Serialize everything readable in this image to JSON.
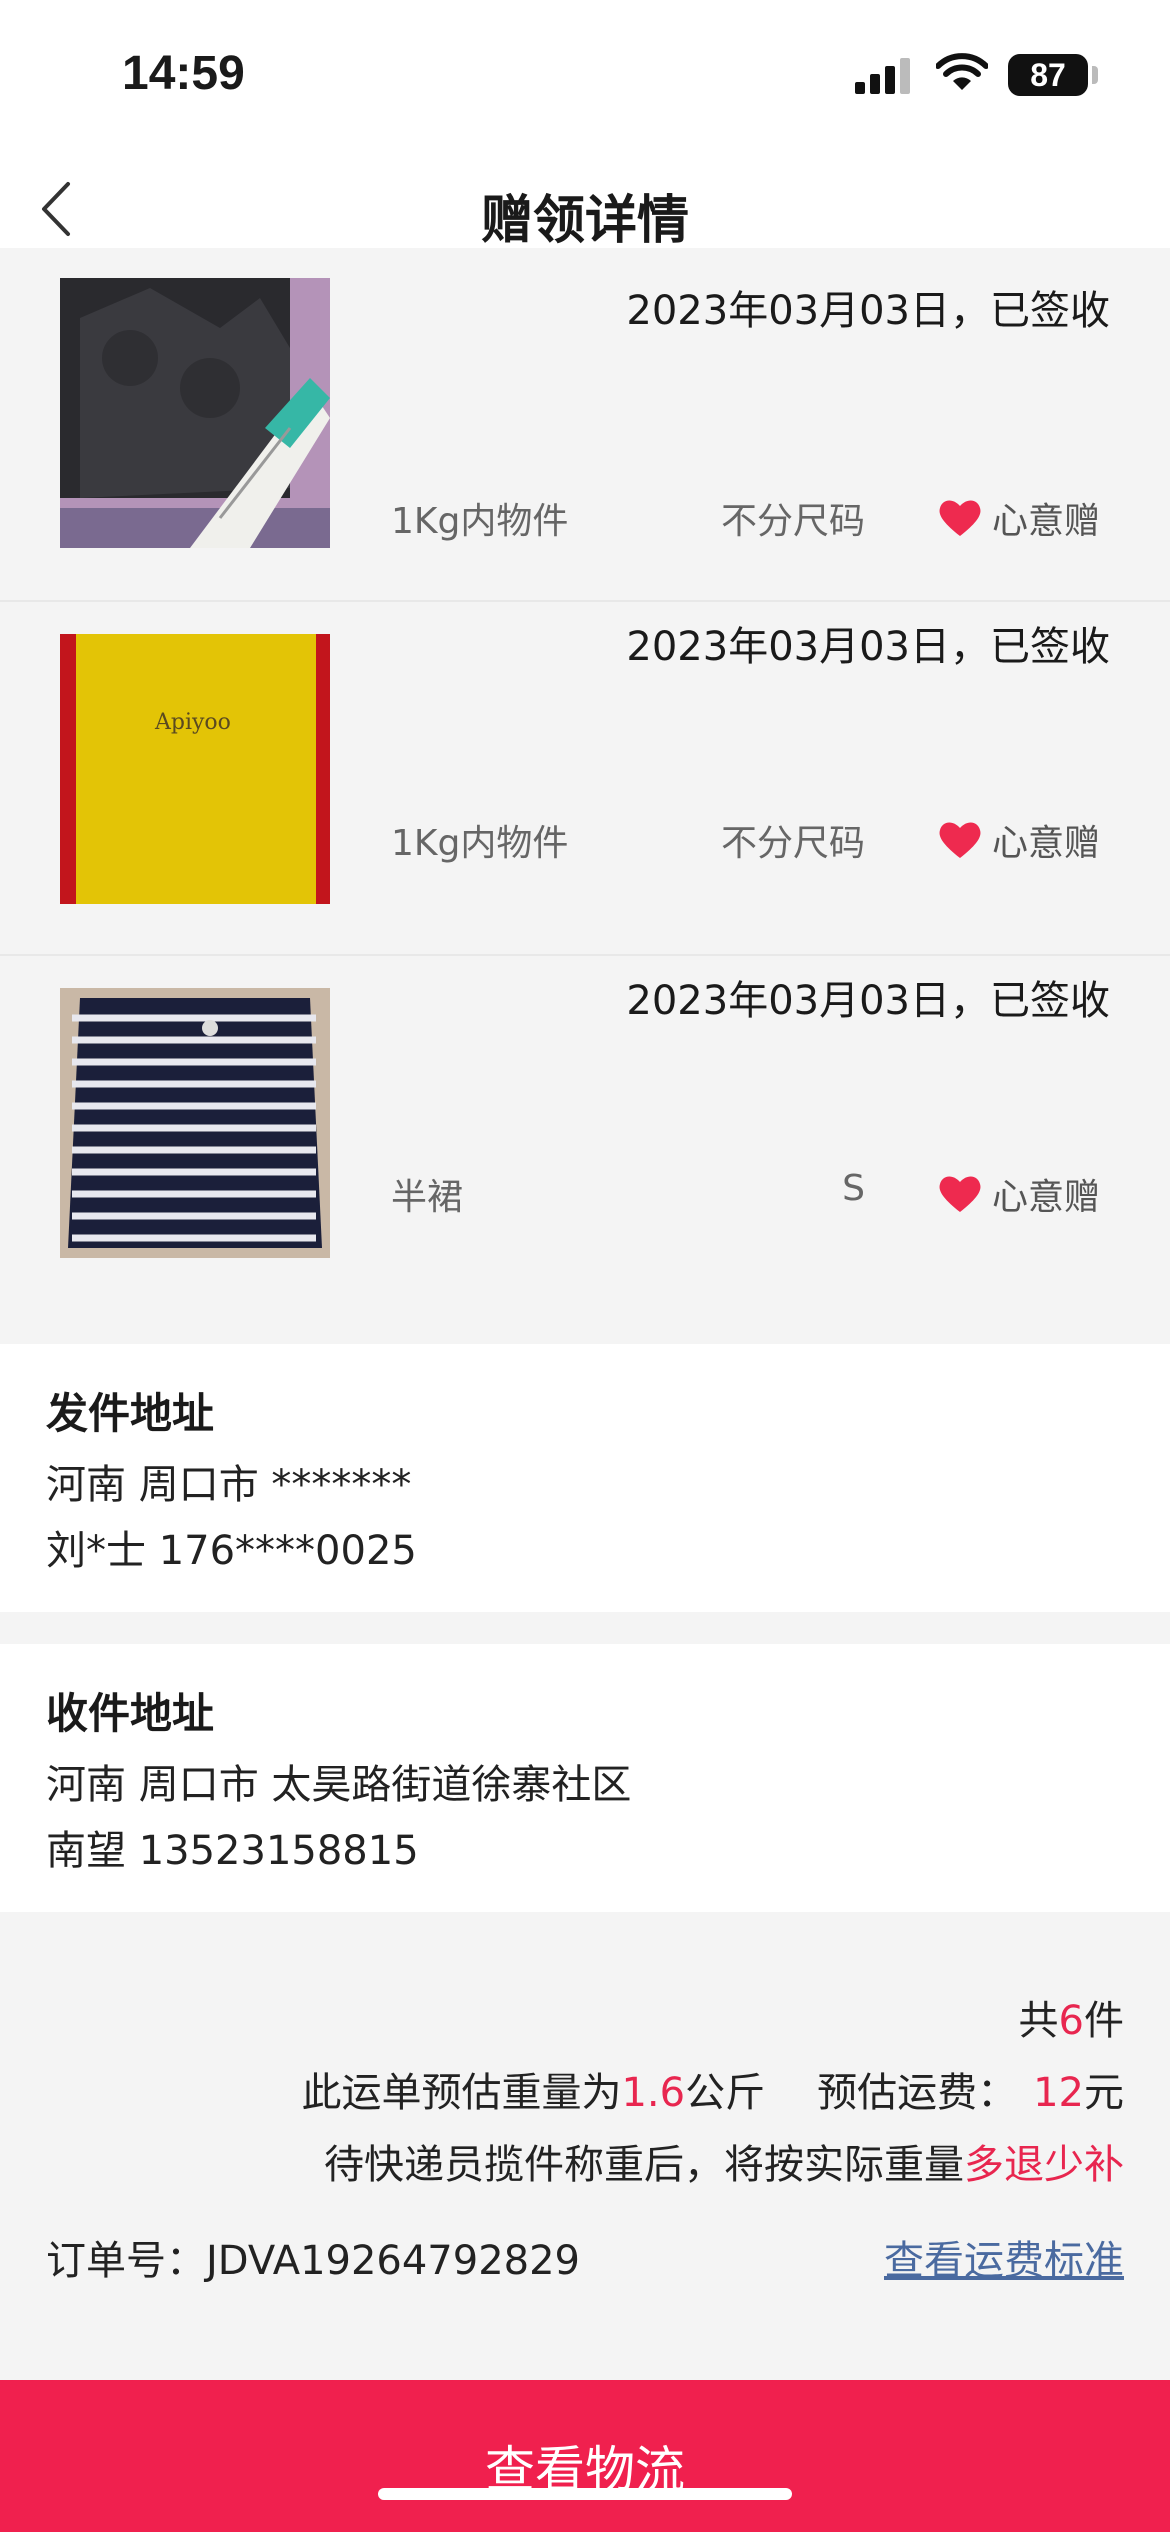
{
  "status": {
    "time": "14:59",
    "battery": "87"
  },
  "nav": {
    "title": "赠领详情"
  },
  "items": [
    {
      "date": "2023年03月03日，已签收",
      "name": "1Kg内物件",
      "size": "不分尺码",
      "gift_label": "心意赠",
      "image": "黑色包与合格证"
    },
    {
      "date": "2023年03月03日，已签收",
      "name": "1Kg内物件",
      "size": "不分尺码",
      "gift_label": "心意赠",
      "image": "黄色包装盒 Apiyoo"
    },
    {
      "date": "2023年03月03日，已签收",
      "name": "半裙",
      "size": "S",
      "gift_label": "心意赠",
      "image": "条纹半裙"
    }
  ],
  "sender": {
    "title": "发件地址",
    "address": "河南 周口市 *******",
    "contact": "刘*士 176****0025"
  },
  "receiver": {
    "title": "收件地址",
    "address": "河南 周口市 太昊路街道徐寨社区",
    "contact": "南望 13523158815"
  },
  "summary": {
    "count_prefix": "共",
    "count": "6",
    "count_suffix": "件",
    "weight_prefix": "此运单预估重量为",
    "weight": "1.6",
    "weight_unit": "公斤",
    "fee_prefix": "预估运费：",
    "fee": "12",
    "fee_unit": "元",
    "note_prefix": "待快递员揽件称重后，将按实际重量",
    "note_highlight": "多退少补"
  },
  "order": {
    "label": "订单号：",
    "number": "JDVA19264792829",
    "rules_link": "查看运费标准"
  },
  "bottom_button": "查看物流",
  "colors": {
    "accent": "#f0204e",
    "highlight": "#e8264f",
    "link": "#4a6aa0"
  }
}
